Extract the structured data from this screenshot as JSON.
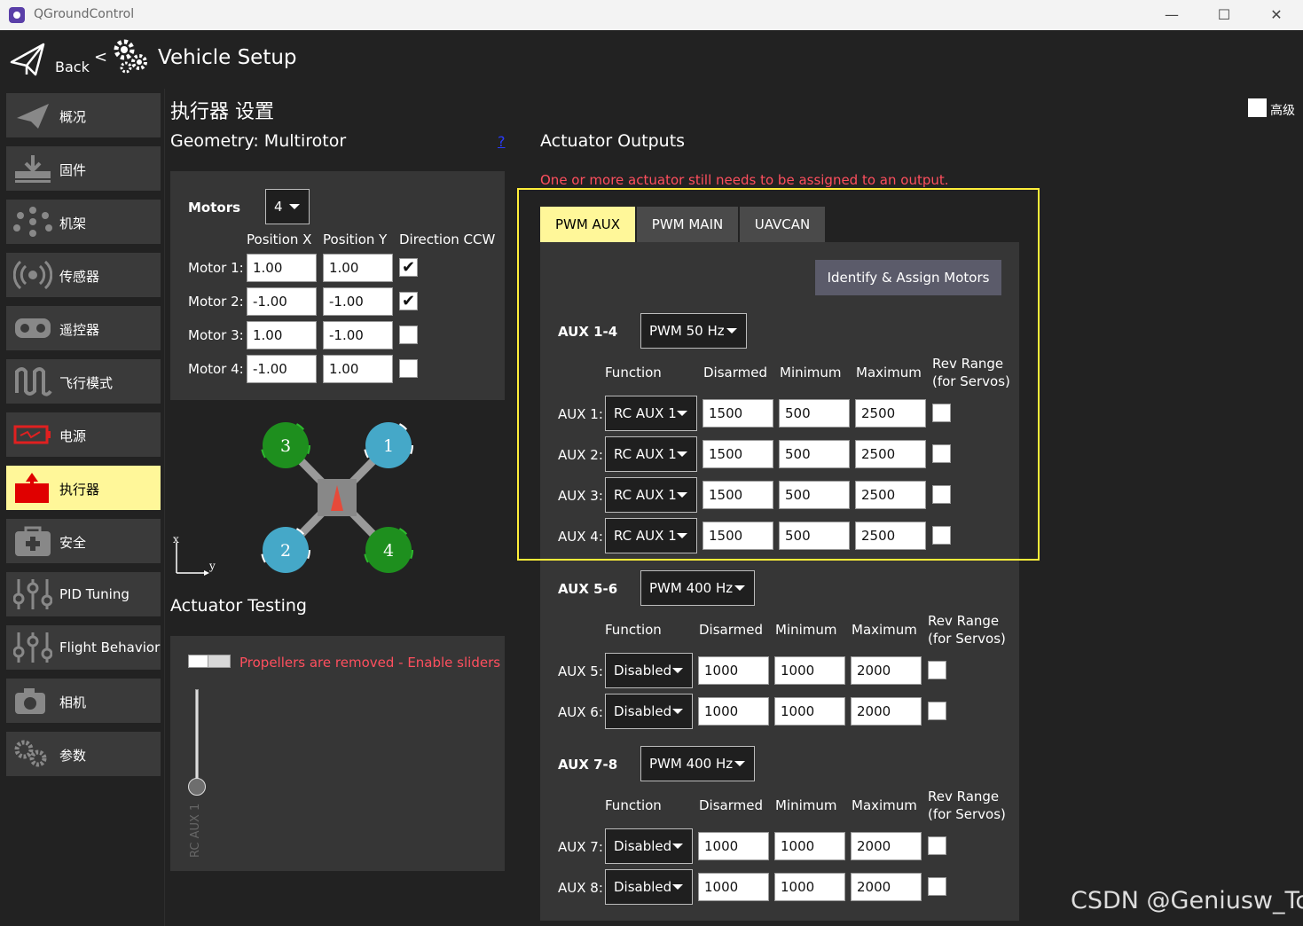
{
  "window": {
    "title": "QGroundControl",
    "minimize": "—",
    "maximize": "☐",
    "close": "✕"
  },
  "header": {
    "back_label": "Back",
    "separator": "<",
    "title": "Vehicle Setup"
  },
  "sidebar": {
    "items": [
      {
        "label": "概况",
        "icon": "paper-plane-icon"
      },
      {
        "label": "固件",
        "icon": "download-icon"
      },
      {
        "label": "机架",
        "icon": "airframe-icon"
      },
      {
        "label": "传感器",
        "icon": "radio-waves-icon"
      },
      {
        "label": "遥控器",
        "icon": "joystick-icon"
      },
      {
        "label": "飞行模式",
        "icon": "wave-icon"
      },
      {
        "label": "电源",
        "icon": "battery-icon"
      },
      {
        "label": "执行器",
        "icon": "actuator-icon"
      },
      {
        "label": "安全",
        "icon": "first-aid-icon"
      },
      {
        "label": "PID Tuning",
        "icon": "sliders-icon"
      },
      {
        "label": "Flight Behavior",
        "icon": "sliders-icon"
      },
      {
        "label": "相机",
        "icon": "camera-icon"
      },
      {
        "label": "参数",
        "icon": "gears-icon"
      }
    ]
  },
  "page": {
    "title": "执行器 设置",
    "advanced_label": "高级"
  },
  "geometry": {
    "title": "Geometry: Multirotor",
    "help": "?",
    "motors_label": "Motors",
    "motors_count": "4",
    "col_pos_x": "Position X",
    "col_pos_y": "Position Y",
    "col_dir": "Direction CCW",
    "rows": [
      {
        "label": "Motor 1:",
        "x": "1.00",
        "y": "1.00",
        "ccw": true
      },
      {
        "label": "Motor 2:",
        "x": "-1.00",
        "y": "-1.00",
        "ccw": true
      },
      {
        "label": "Motor 3:",
        "x": "1.00",
        "y": "-1.00",
        "ccw": false
      },
      {
        "label": "Motor 4:",
        "x": "-1.00",
        "y": "1.00",
        "ccw": false
      }
    ],
    "diagram": {
      "m1": "1",
      "m2": "2",
      "m3": "3",
      "m4": "4",
      "axis_x": "x",
      "axis_y": "y",
      "ccw_color": "#45a8c8",
      "cw_color": "#1e8f1e"
    }
  },
  "testing": {
    "title": "Actuator Testing",
    "warning": "Propellers are removed - Enable sliders",
    "slider_label": "RC AUX 1"
  },
  "outputs": {
    "title": "Actuator Outputs",
    "warning": "One or more actuator still needs to be assigned to an output.",
    "tabs": [
      "PWM AUX",
      "PWM MAIN",
      "UAVCAN"
    ],
    "identify_button": "Identify & Assign Motors",
    "col_function": "Function",
    "col_disarmed": "Disarmed",
    "col_minimum": "Minimum",
    "col_maximum": "Maximum",
    "col_rev_1": "Rev Range",
    "col_rev_2": "(for Servos)",
    "groups": [
      {
        "label": "AUX 1-4",
        "rate": "PWM 50 Hz",
        "rows": [
          {
            "label": "AUX 1:",
            "function": "RC AUX 1",
            "disarmed": "1500",
            "min": "500",
            "max": "2500"
          },
          {
            "label": "AUX 2:",
            "function": "RC AUX 1",
            "disarmed": "1500",
            "min": "500",
            "max": "2500"
          },
          {
            "label": "AUX 3:",
            "function": "RC AUX 1",
            "disarmed": "1500",
            "min": "500",
            "max": "2500"
          },
          {
            "label": "AUX 4:",
            "function": "RC AUX 1",
            "disarmed": "1500",
            "min": "500",
            "max": "2500"
          }
        ]
      },
      {
        "label": "AUX 5-6",
        "rate": "PWM 400 Hz",
        "rows": [
          {
            "label": "AUX 5:",
            "function": "Disabled",
            "disarmed": "1000",
            "min": "1000",
            "max": "2000"
          },
          {
            "label": "AUX 6:",
            "function": "Disabled",
            "disarmed": "1000",
            "min": "1000",
            "max": "2000"
          }
        ]
      },
      {
        "label": "AUX 7-8",
        "rate": "PWM 400 Hz",
        "rows": [
          {
            "label": "AUX 7:",
            "function": "Disabled",
            "disarmed": "1000",
            "min": "1000",
            "max": "2000"
          },
          {
            "label": "AUX 8:",
            "function": "Disabled",
            "disarmed": "1000",
            "min": "1000",
            "max": "2000"
          }
        ]
      }
    ]
  },
  "watermark": "CSDN @Geniusw_Tc"
}
